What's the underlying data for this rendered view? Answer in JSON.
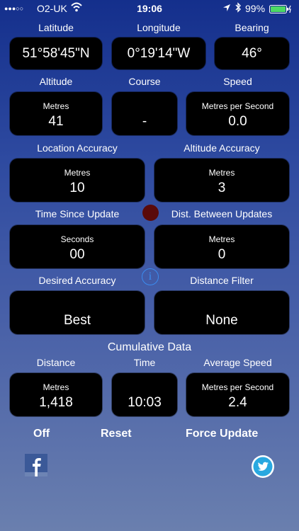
{
  "status": {
    "carrier": "O2-UK",
    "time": "19:06",
    "battery": "99%"
  },
  "labels": {
    "latitude": "Latitude",
    "longitude": "Longitude",
    "bearing": "Bearing",
    "altitude": "Altitude",
    "course": "Course",
    "speed": "Speed",
    "location_accuracy": "Location Accuracy",
    "altitude_accuracy": "Altitude Accuracy",
    "time_since_update": "Time Since Update",
    "dist_between_updates": "Dist. Between Updates",
    "desired_accuracy": "Desired Accuracy",
    "distance_filter": "Distance Filter",
    "cumulative": "Cumulative Data",
    "distance": "Distance",
    "time": "Time",
    "average_speed": "Average Speed"
  },
  "values": {
    "latitude": "51°58'45\"N",
    "longitude": "0°19'14\"W",
    "bearing": "46°",
    "altitude_unit": "Metres",
    "altitude": "41",
    "course": "-",
    "speed_unit": "Metres per Second",
    "speed": "0.0",
    "loc_acc_unit": "Metres",
    "loc_acc": "10",
    "alt_acc_unit": "Metres",
    "alt_acc": "3",
    "tsu_unit": "Seconds",
    "tsu": "00",
    "dbu_unit": "Metres",
    "dbu": "0",
    "desired_accuracy": "Best",
    "distance_filter": "None",
    "cum_dist_unit": "Metres",
    "cum_dist": "1,418",
    "cum_time": "10:03",
    "avg_speed_unit": "Metres per Second",
    "avg_speed": "2.4"
  },
  "buttons": {
    "off": "Off",
    "reset": "Reset",
    "force_update": "Force Update"
  },
  "info_glyph": "i",
  "icons": {
    "facebook": "facebook-icon",
    "twitter": "twitter-icon",
    "location": "location-arrow-icon",
    "bluetooth": "bluetooth-icon",
    "wifi": "wifi-icon"
  },
  "colors": {
    "accent": "#3b8cf0",
    "update_indicator": "#5a0a0a",
    "background_top": "#142f8c",
    "background_bottom": "#6a7fae"
  }
}
